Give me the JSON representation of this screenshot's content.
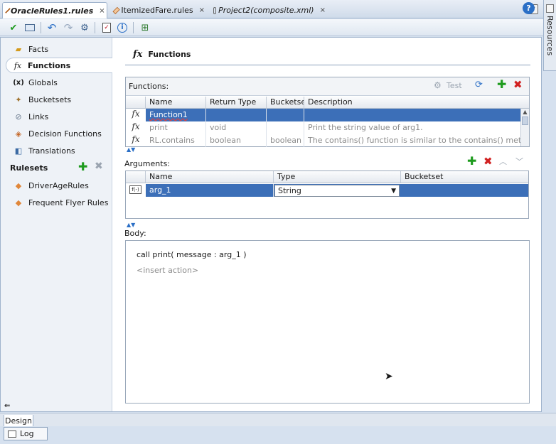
{
  "tabs": [
    {
      "label": "OracleRules1.rules",
      "close": "×",
      "active": true,
      "icon": "rules-diamond-icon"
    },
    {
      "label": "ItemizedFare.rules",
      "close": "×",
      "active": false,
      "icon": "rules-diamond-icon"
    },
    {
      "label": "Project2(composite.xml)",
      "close": "×",
      "active": false,
      "icon": "composite-icon"
    }
  ],
  "resources": {
    "label": "Resources"
  },
  "toolbar": {
    "icons": [
      "validate-check-icon",
      "book-icon",
      "undo-icon",
      "redo-icon",
      "test-icon",
      "checklist-icon",
      "info-icon",
      "deploy-icon"
    ],
    "help_label": "?"
  },
  "nav": {
    "items": [
      {
        "label": "Facts",
        "icon": "facts-icon"
      },
      {
        "label": "Functions",
        "icon": "fx-icon"
      },
      {
        "label": "Globals",
        "icon": "globals-icon",
        "glyph": "(x)"
      },
      {
        "label": "Bucketsets",
        "icon": "bucketsets-icon"
      },
      {
        "label": "Links",
        "icon": "links-icon"
      },
      {
        "label": "Decision Functions",
        "icon": "decision-functions-icon"
      },
      {
        "label": "Translations",
        "icon": "translations-icon"
      }
    ],
    "rulesets_label": "Rulesets",
    "rulesets": [
      {
        "label": "DriverAgeRules"
      },
      {
        "label": "Frequent Flyer Rules"
      }
    ]
  },
  "page": {
    "title": "Functions",
    "title_glyph": "fx"
  },
  "functions": {
    "label": "Functions:",
    "test_label": "Test",
    "columns": [
      "Name",
      "Return Type",
      "Bucketse",
      "Description"
    ],
    "rows": [
      {
        "name": "Function1",
        "return_type": "",
        "bucketset": "",
        "description": "",
        "selected": true
      },
      {
        "name": "print",
        "return_type": "void",
        "bucketset": "",
        "description": "Print the string value of arg1.",
        "selected": false
      },
      {
        "name": "RL.contains",
        "return_type": "boolean",
        "bucketset": "boolean",
        "description": "The contains() function is similar to the contains() met...",
        "selected": false
      }
    ]
  },
  "arguments": {
    "label": "Arguments:",
    "columns": [
      "Name",
      "Type",
      "Bucketset"
    ],
    "rows": [
      {
        "icon_text": "f(-)",
        "name": "arg_1",
        "type": "String",
        "bucketset": ""
      }
    ]
  },
  "body": {
    "label": "Body:",
    "line1": "call print( message : arg_1 )",
    "placeholder": "<insert action>"
  },
  "bottom": {
    "design_tab": "Design",
    "log_tab": "Log"
  },
  "colors": {
    "selection": "#3c6fb8",
    "accent": "#2b6fc6",
    "add": "#1e9b1e",
    "delete": "#d12020"
  }
}
